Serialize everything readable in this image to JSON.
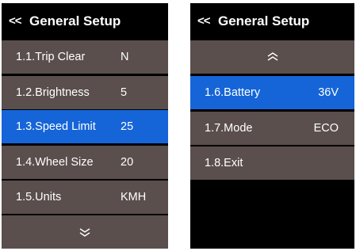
{
  "left_screen": {
    "header": {
      "back": "<<",
      "title": "General Setup"
    },
    "items": [
      {
        "label": "1.1.Trip Clear",
        "value": "N"
      },
      {
        "label": "1.2.Brightness",
        "value": "5"
      },
      {
        "label": "1.3.Speed Limit",
        "value": "25",
        "selected": true
      },
      {
        "label": "1.4.Wheel Size",
        "value": "20"
      },
      {
        "label": "1.5.Units",
        "value": "KMH"
      }
    ],
    "scroll_icon": "double-chevron-down-icon"
  },
  "right_screen": {
    "header": {
      "back": "<<",
      "title": "General Setup"
    },
    "scroll_icon": "double-chevron-up-icon",
    "items": [
      {
        "label": "1.6.Battery",
        "value": "36V",
        "selected": true
      },
      {
        "label": "1.7.Mode",
        "value": "ECO"
      },
      {
        "label": "1.8.Exit",
        "value": ""
      }
    ]
  },
  "colors": {
    "background": "#000000",
    "row": "#5a4f4d",
    "selected": "#1565d8",
    "text": "#ffffff"
  }
}
